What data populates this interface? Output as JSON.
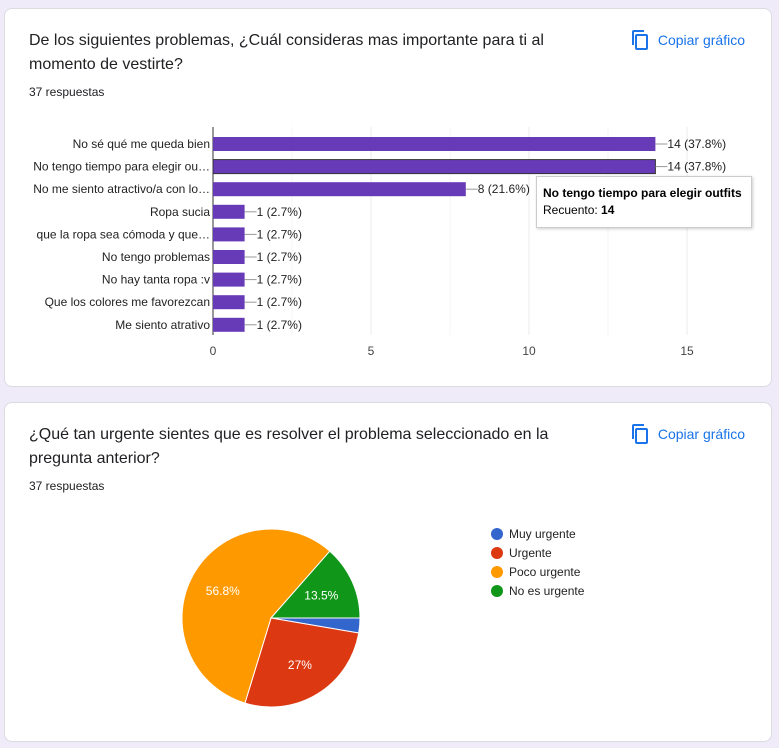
{
  "questions": [
    {
      "title": "De los siguientes problemas, ¿Cuál consideras mas importante para ti al momento de vestirte?",
      "responses": "37 respuestas",
      "copy_label": "Copiar gráfico",
      "tooltip": {
        "title": "No tengo tiempo para elegir outfits",
        "count_label": "Recuento:",
        "count": "14"
      }
    },
    {
      "title": "¿Qué tan urgente sientes que es resolver el problema seleccionado en la pregunta anterior?",
      "responses": "37 respuestas",
      "copy_label": "Copiar gráfico"
    }
  ],
  "chart_data": [
    {
      "type": "bar",
      "orientation": "horizontal",
      "categories": [
        "No sé qué me queda bien",
        "No tengo tiempo para elegir ou…",
        "No me siento atractivo/a con lo…",
        "Ropa sucia",
        "que la ropa sea cómoda y que…",
        "No tengo problemas",
        "No hay tanta ropa :v",
        "Que los colores me favorezcan",
        "Me siento atrativo"
      ],
      "values": [
        14,
        14,
        8,
        1,
        1,
        1,
        1,
        1,
        1
      ],
      "data_labels": [
        "14 (37.8%)",
        "14 (37.8%)",
        "8 (21.6%)",
        "1 (2.7%)",
        "1 (2.7%)",
        "1 (2.7%)",
        "1 (2.7%)",
        "1 (2.7%)",
        "1 (2.7%)"
      ],
      "xlim": [
        0,
        15
      ],
      "xticks": [
        "0",
        "5",
        "10",
        "15"
      ],
      "grid": true,
      "color": "#673ab7"
    },
    {
      "type": "pie",
      "categories": [
        "Muy urgente",
        "Urgente",
        "Poco urgente",
        "No es urgente"
      ],
      "values": [
        1,
        10,
        21,
        5
      ],
      "slice_labels": [
        "",
        "27%",
        "56.8%",
        "13.5%"
      ],
      "colors": [
        "#3366cc",
        "#dc3912",
        "#ff9900",
        "#109618"
      ],
      "legend": "right"
    }
  ]
}
